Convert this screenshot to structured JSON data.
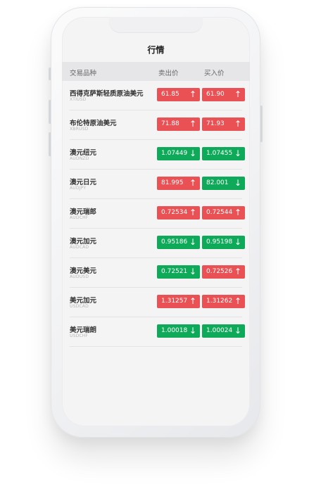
{
  "header": {
    "title": "行情",
    "col_symbol": "交易品种",
    "col_sell": "卖出价",
    "col_buy": "买入价"
  },
  "colors": {
    "up": "#ea5154",
    "down": "#0eaa5a"
  },
  "quotes": [
    {
      "name": "西得克萨斯轻质原油美元",
      "code": "XTIUSD",
      "sell": "61.85",
      "buy": "61.90",
      "trend": "up",
      "sell_icon": "arrow-up-icon",
      "buy_icon": "arrow-up-icon"
    },
    {
      "name": "布伦特原油美元",
      "code": "XBRUSD",
      "sell": "71.88",
      "buy": "71.93",
      "trend": "up",
      "sell_icon": "arrow-up-icon",
      "buy_icon": "arrow-up-icon"
    },
    {
      "name": "澳元纽元",
      "code": "AUDNZD",
      "sell": "1.07449",
      "buy": "1.07455",
      "trend": "down",
      "sell_icon": "arrow-down-icon",
      "buy_icon": "arrow-down-icon"
    },
    {
      "name": "澳元日元",
      "code": "AUDJPY",
      "sell": "81.995",
      "buy": "82.001",
      "trend": "mixed",
      "sell_icon": "arrow-up-icon",
      "buy_icon": "arrow-down-icon"
    },
    {
      "name": "澳元瑞郎",
      "code": "AUDCHF",
      "sell": "0.72534",
      "buy": "0.72544",
      "trend": "up",
      "sell_icon": "arrow-up-icon",
      "buy_icon": "arrow-up-icon"
    },
    {
      "name": "澳元加元",
      "code": "AUDCAD",
      "sell": "0.95186",
      "buy": "0.95198",
      "trend": "down",
      "sell_icon": "arrow-down-icon",
      "buy_icon": "arrow-down-icon"
    },
    {
      "name": "澳元美元",
      "code": "AUDUSD",
      "sell": "0.72521",
      "buy": "0.72526",
      "trend": "mixed",
      "sell_icon": "arrow-down-icon",
      "buy_icon": "arrow-up-icon"
    },
    {
      "name": "美元加元",
      "code": "USDCAD",
      "sell": "1.31257",
      "buy": "1.31262",
      "trend": "up",
      "sell_icon": "arrow-up-icon",
      "buy_icon": "arrow-up-icon"
    },
    {
      "name": "美元瑞朗",
      "code": "USDCHF",
      "sell": "1.00018",
      "buy": "1.00024",
      "trend": "down",
      "sell_icon": "arrow-down-icon",
      "buy_icon": "arrow-down-icon"
    }
  ]
}
